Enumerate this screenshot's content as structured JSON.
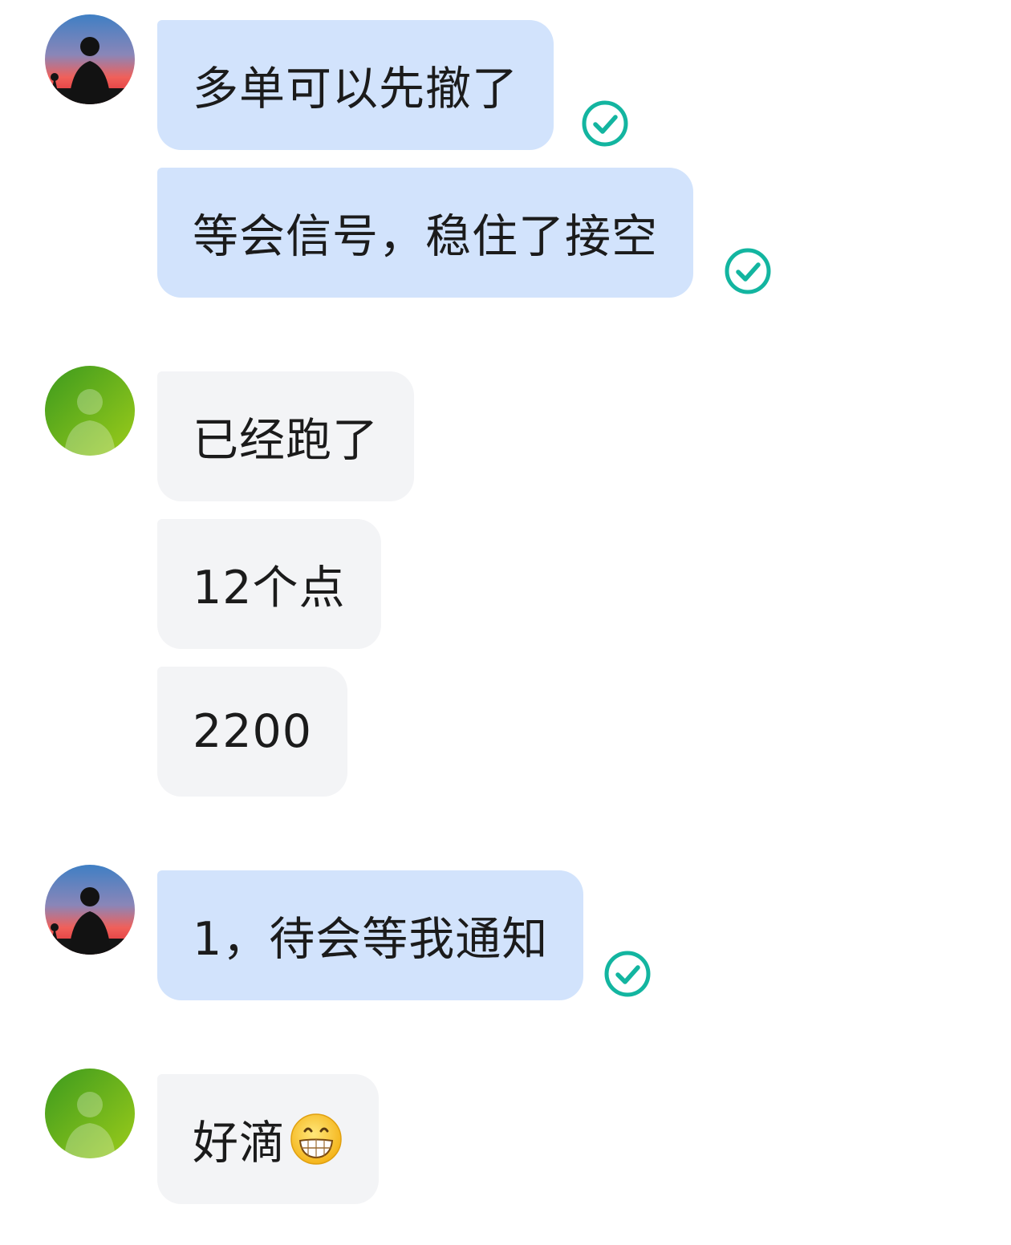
{
  "messages": [
    {
      "sender": "me",
      "avatar": "sunset-silhouette-avatar",
      "text": "多单可以先撤了",
      "status": "read-check-icon"
    },
    {
      "sender": "me",
      "text": "等会信号，稳住了接空",
      "status": "read-check-icon"
    },
    {
      "sender": "peer",
      "avatar": "default-person-avatar",
      "text": "已经跑了"
    },
    {
      "sender": "peer",
      "text": "12个点"
    },
    {
      "sender": "peer",
      "text": "2200"
    },
    {
      "sender": "me",
      "avatar": "sunset-silhouette-avatar",
      "text": "1，待会等我通知",
      "status": "read-check-icon"
    },
    {
      "sender": "peer",
      "avatar": "default-person-avatar",
      "text": "好滴",
      "emoji": "grinning-face-emoji"
    }
  ],
  "colors": {
    "my_bubble": "#d2e3fc",
    "peer_bubble": "#f3f4f6",
    "read_check": "#13b5a0",
    "peer_avatar": "#6ab51c"
  }
}
